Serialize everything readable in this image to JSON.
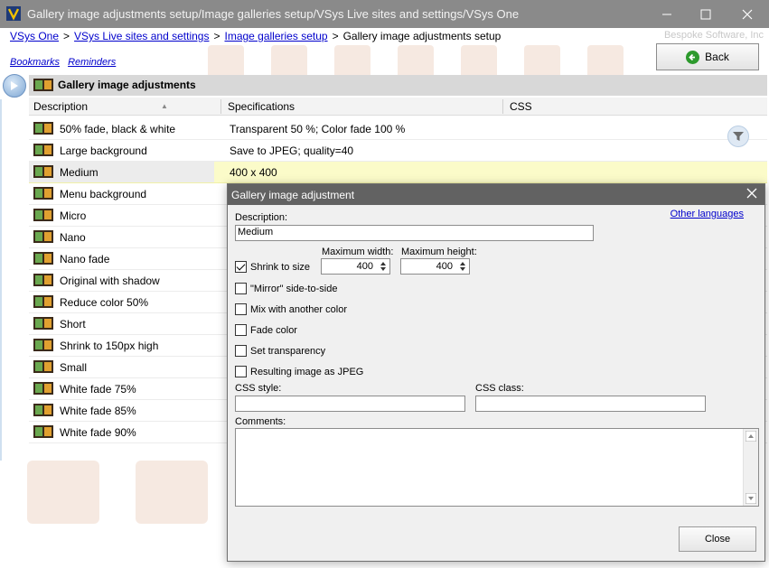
{
  "window": {
    "title": "Gallery image adjustments setup/Image galleries setup/VSys Live sites and settings/VSys One",
    "company": "Bespoke Software, Inc"
  },
  "breadcrumb": {
    "items": [
      "VSys One",
      "VSys Live sites and settings",
      "Image galleries setup"
    ],
    "current": "Gallery image adjustments setup",
    "separator": ">"
  },
  "links": {
    "bookmarks": "Bookmarks",
    "reminders": "Reminders"
  },
  "back_button": {
    "label": "Back"
  },
  "section": {
    "title": "Gallery image adjustments"
  },
  "grid": {
    "columns": [
      "Description",
      "Specifications",
      "CSS"
    ],
    "sort_indicator": "▲",
    "rows": [
      {
        "description": "50% fade, black & white",
        "spec": "Transparent 50 %; Color fade 100 %",
        "css": ""
      },
      {
        "description": "Large background",
        "spec": "Save to JPEG; quality=40",
        "css": ""
      },
      {
        "description": "Medium",
        "spec": "400 x 400",
        "css": "",
        "selected": true
      },
      {
        "description": "Menu background",
        "spec": "",
        "css": ""
      },
      {
        "description": "Micro",
        "spec": "",
        "css": ""
      },
      {
        "description": "Nano",
        "spec": "",
        "css": ""
      },
      {
        "description": "Nano fade",
        "spec": "",
        "css": ""
      },
      {
        "description": "Original with shadow",
        "spec": "",
        "css": ""
      },
      {
        "description": "Reduce color 50%",
        "spec": "",
        "css": ""
      },
      {
        "description": "Short",
        "spec": "",
        "css": ""
      },
      {
        "description": "Shrink to 150px high",
        "spec": "",
        "css": ""
      },
      {
        "description": "Small",
        "spec": "",
        "css": ""
      },
      {
        "description": "White fade 75%",
        "spec": "",
        "css": ""
      },
      {
        "description": "White fade 85%",
        "spec": "",
        "css": ""
      },
      {
        "description": "White fade 90%",
        "spec": "",
        "css": ""
      }
    ]
  },
  "dialog": {
    "title": "Gallery image adjustment",
    "other_languages": "Other languages",
    "description_label": "Description:",
    "description_value": "Medium",
    "max_width_label": "Maximum width:",
    "max_width_value": "400",
    "max_height_label": "Maximum height:",
    "max_height_value": "400",
    "checkboxes": [
      {
        "label": "Shrink to size",
        "checked": true
      },
      {
        "label": "\"Mirror\" side-to-side",
        "checked": false
      },
      {
        "label": "Mix with another color",
        "checked": false
      },
      {
        "label": "Fade color",
        "checked": false
      },
      {
        "label": "Set transparency",
        "checked": false
      },
      {
        "label": "Resulting image as JPEG",
        "checked": false
      }
    ],
    "css_style_label": "CSS style:",
    "css_style_value": "",
    "css_class_label": "CSS class:",
    "css_class_value": "",
    "comments_label": "Comments:",
    "comments_value": "",
    "close_label": "Close"
  },
  "colors": {
    "titlebar": "#8a8a8a",
    "dialog_header": "#626262",
    "selected_row": "#fbfbc9",
    "link": "#0000cc"
  }
}
